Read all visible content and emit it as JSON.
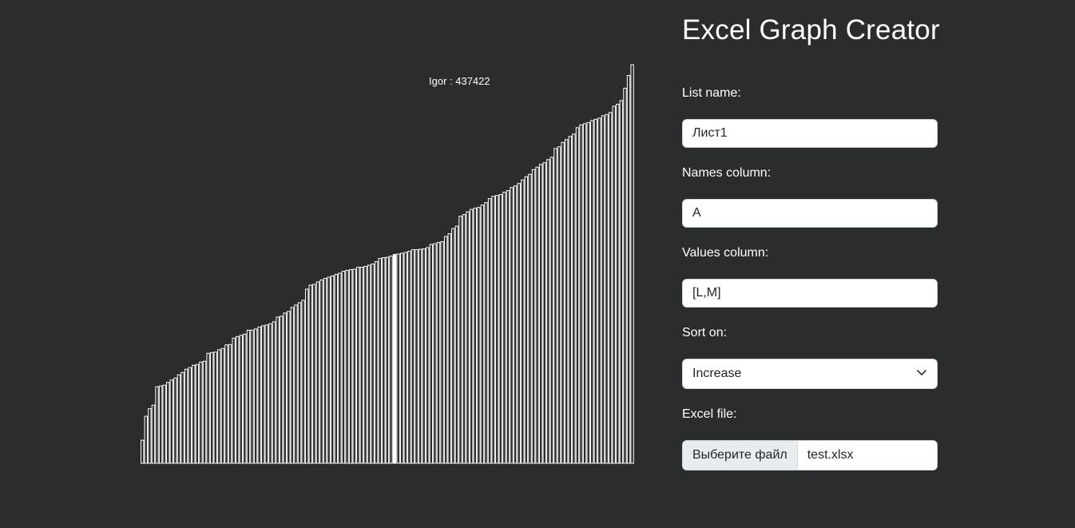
{
  "app": {
    "title": "Excel Graph Creator"
  },
  "form": {
    "list_name_label": "List name:",
    "list_name_value": "Лист1",
    "names_column_label": "Names column:",
    "names_column_value": "A",
    "values_column_label": "Values column:",
    "values_column_value": "[L,M]",
    "sort_label": "Sort on:",
    "sort_value": "Increase",
    "file_label": "Excel file:",
    "file_button_label": "Выберите файл",
    "file_name": "test.xlsx"
  },
  "chart_data": {
    "type": "bar",
    "sort": "increase",
    "hover": {
      "label": "Igor : 437422",
      "highlighted_index": 69
    },
    "values": [
      58,
      118,
      137,
      146,
      192,
      194,
      196,
      203,
      209,
      214,
      222,
      228,
      236,
      240,
      246,
      248,
      254,
      256,
      276,
      278,
      279,
      285,
      288,
      297,
      298,
      314,
      318,
      321,
      324,
      334,
      334,
      337,
      342,
      345,
      347,
      350,
      355,
      367,
      369,
      377,
      381,
      391,
      397,
      403,
      409,
      437,
      447,
      449,
      455,
      460,
      464,
      467,
      470,
      474,
      477,
      482,
      484,
      486,
      487,
      492,
      492,
      494,
      497,
      500,
      506,
      514,
      516,
      517,
      520,
      524,
      525,
      527,
      529,
      532,
      536,
      536,
      537,
      538,
      541,
      549,
      551,
      554,
      556,
      569,
      576,
      589,
      595,
      620,
      624,
      631,
      637,
      640,
      642,
      648,
      654,
      664,
      670,
      672,
      674,
      680,
      684,
      692,
      696,
      702,
      711,
      719,
      725,
      737,
      743,
      750,
      754,
      762,
      768,
      790,
      794,
      805,
      812,
      820,
      826,
      842,
      849,
      852,
      855,
      860,
      863,
      866,
      872,
      875,
      880,
      896,
      901,
      910,
      941,
      973,
      1000
    ]
  },
  "colors": {
    "background": "#2b2d2d",
    "bar_stroke": "#ffffff",
    "bar_highlight": "#ffffff"
  }
}
